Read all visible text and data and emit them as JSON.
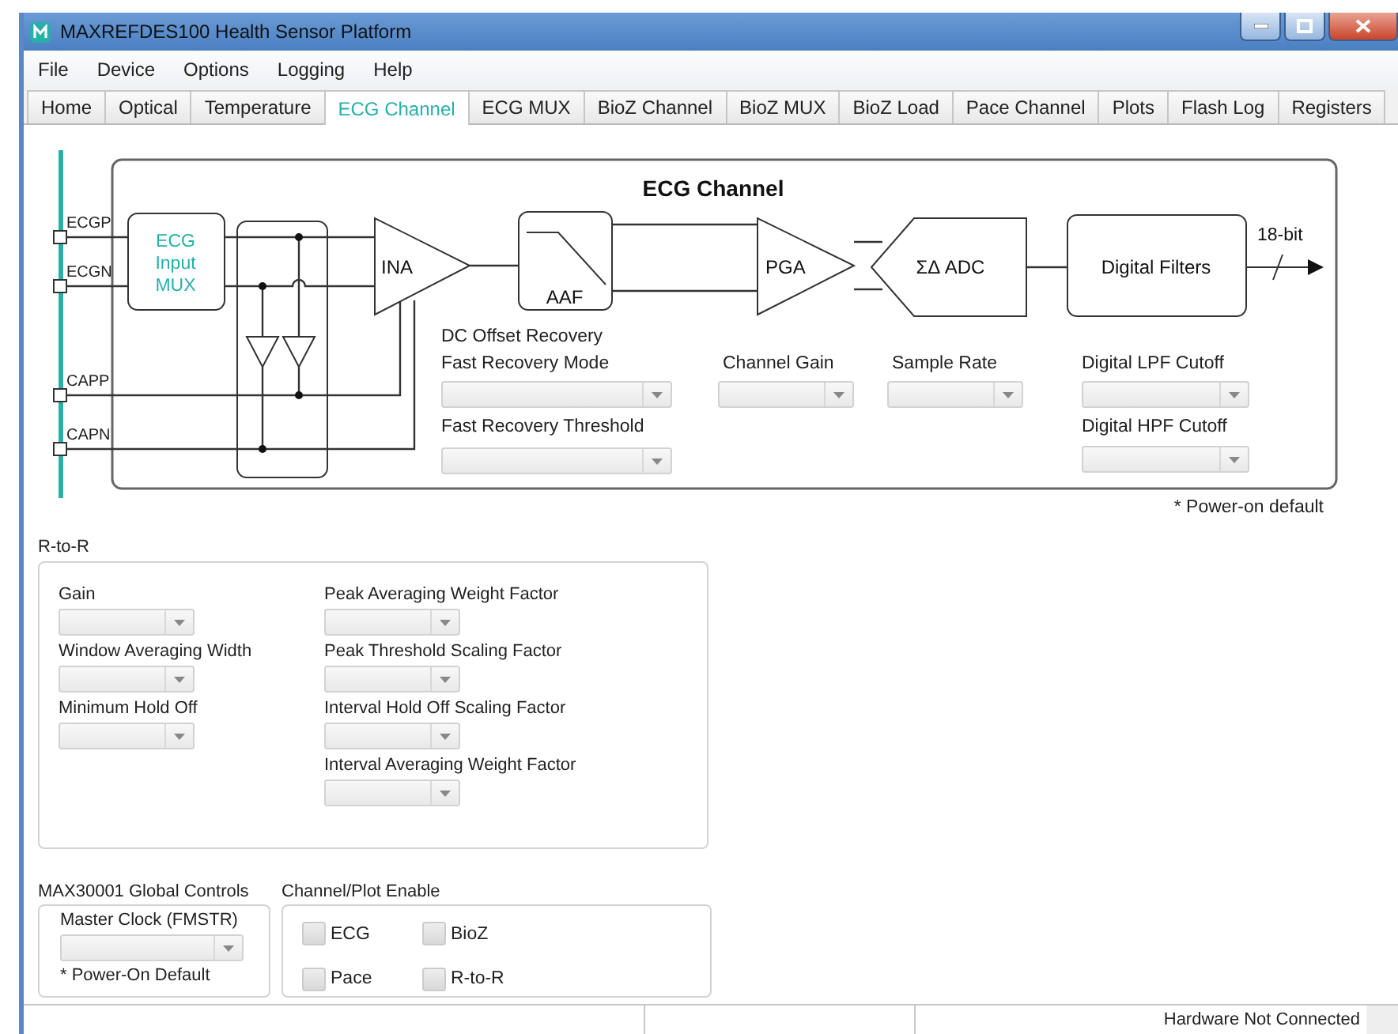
{
  "window": {
    "title": "MAXREFDES100 Health Sensor Platform"
  },
  "menu": [
    "File",
    "Device",
    "Options",
    "Logging",
    "Help"
  ],
  "tabs": [
    {
      "label": "Home",
      "selected": false
    },
    {
      "label": "Optical",
      "selected": false
    },
    {
      "label": "Temperature",
      "selected": false
    },
    {
      "label": "ECG Channel",
      "selected": true
    },
    {
      "label": "ECG MUX",
      "selected": false
    },
    {
      "label": "BioZ Channel",
      "selected": false
    },
    {
      "label": "BioZ MUX",
      "selected": false
    },
    {
      "label": "BioZ Load",
      "selected": false
    },
    {
      "label": "Pace Channel",
      "selected": false
    },
    {
      "label": "Plots",
      "selected": false
    },
    {
      "label": "Flash Log",
      "selected": false
    },
    {
      "label": "Registers",
      "selected": false
    }
  ],
  "ecg_channel": {
    "title": "ECG Channel",
    "pins": [
      "ECGP",
      "ECGN",
      "CAPP",
      "CAPN"
    ],
    "mux_label": [
      "ECG",
      "Input",
      "MUX"
    ],
    "ina": "INA",
    "aaf": "AAF",
    "pga": "PGA",
    "adc": "ΣΔ ADC",
    "filters": "Digital Filters",
    "output": "18-bit",
    "dc_offset_heading": "DC Offset Recovery",
    "controls": [
      {
        "label": "Fast Recovery Mode"
      },
      {
        "label": "Fast Recovery Threshold"
      },
      {
        "label": "Channel Gain"
      },
      {
        "label": "Sample Rate"
      },
      {
        "label": "Digital LPF Cutoff"
      },
      {
        "label": "Digital HPF Cutoff"
      }
    ],
    "footnote": "* Power-on default"
  },
  "r_to_r": {
    "title": "R-to-R",
    "left": [
      "Gain",
      "Window Averaging Width",
      "Minimum Hold Off"
    ],
    "right": [
      "Peak Averaging Weight Factor",
      "Peak Threshold Scaling Factor",
      "Interval Hold Off Scaling Factor",
      "Interval Averaging Weight Factor"
    ]
  },
  "global_controls": {
    "title": "MAX30001 Global Controls",
    "label": "Master Clock (FMSTR)",
    "note": "* Power-On Default"
  },
  "channel_plot_enable": {
    "title": "Channel/Plot Enable",
    "options": [
      {
        "label": "ECG",
        "checked": false
      },
      {
        "label": "BioZ",
        "checked": false
      },
      {
        "label": "Pace",
        "checked": false
      },
      {
        "label": "R-to-R",
        "checked": false
      }
    ]
  },
  "status_bar": {
    "status": "Hardware Not Connected"
  }
}
